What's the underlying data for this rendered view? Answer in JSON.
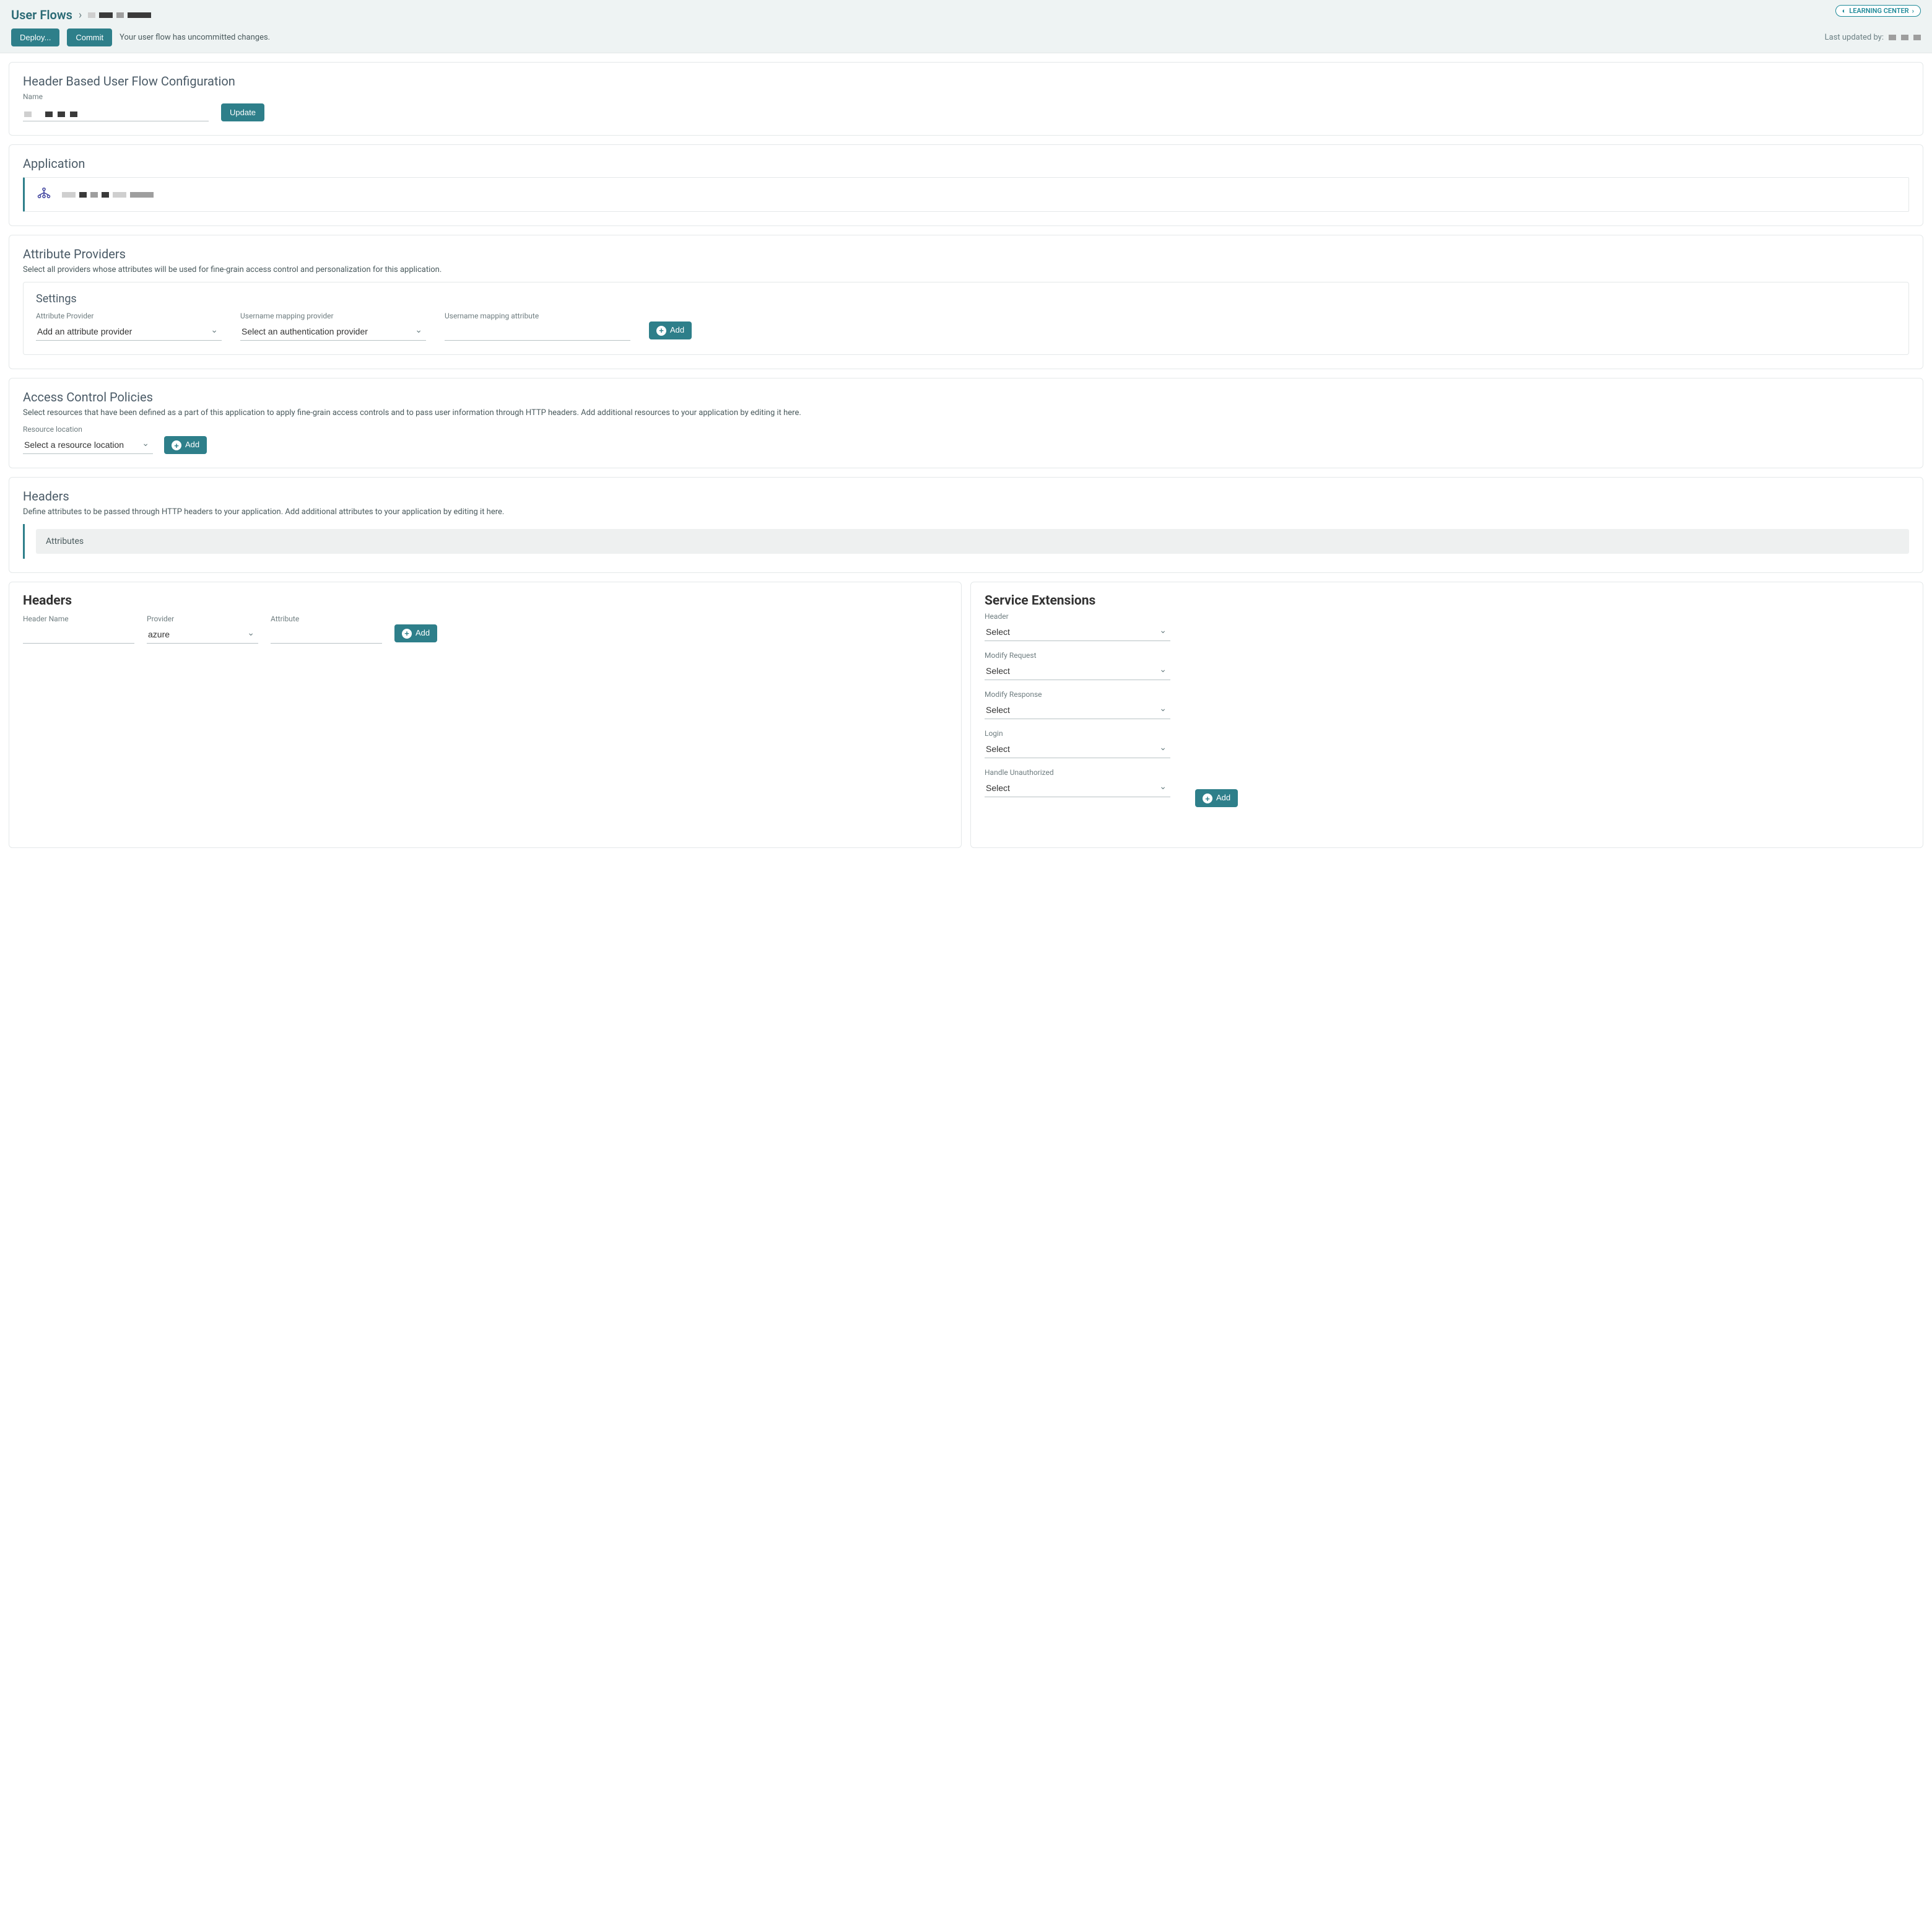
{
  "header": {
    "breadcrumb_root": "User Flows",
    "learning_center_label": "LEARNING CENTER",
    "deploy_label": "Deploy...",
    "commit_label": "Commit",
    "uncommitted_msg": "Your user flow has uncommitted changes.",
    "last_updated_label": "Last updated by:"
  },
  "config": {
    "title": "Header Based User Flow Configuration",
    "name_label": "Name",
    "update_label": "Update"
  },
  "application": {
    "title": "Application"
  },
  "providers": {
    "title": "Attribute Providers",
    "desc": "Select all providers whose attributes will be used for fine-grain access control and personalization for this application.",
    "settings_title": "Settings",
    "attr_provider_label": "Attribute Provider",
    "attr_provider_placeholder": "Add an attribute provider",
    "user_map_provider_label": "Username mapping provider",
    "user_map_provider_placeholder": "Select an authentication provider",
    "user_map_attr_label": "Username mapping attribute",
    "add_label": "Add"
  },
  "acp": {
    "title": "Access Control Policies",
    "desc": "Select resources that have been defined as a part of this application to apply fine-grain access controls and to pass user information through HTTP headers. Add additional resources to your application by editing it here.",
    "resource_label": "Resource location",
    "resource_placeholder": "Select a resource location",
    "add_label": "Add"
  },
  "headers_section": {
    "title": "Headers",
    "desc": "Define attributes to be passed through HTTP headers to your application. Add additional attributes to your application by editing it here.",
    "attributes_label": "Attributes"
  },
  "headers_form": {
    "title": "Headers",
    "header_name_label": "Header Name",
    "provider_label": "Provider",
    "provider_value": "azure",
    "attribute_label": "Attribute",
    "add_label": "Add"
  },
  "service_ext": {
    "title": "Service Extensions",
    "add_label": "Add",
    "fields": {
      "header": {
        "label": "Header",
        "value": "Select"
      },
      "modify_request": {
        "label": "Modify Request",
        "value": "Select"
      },
      "modify_response": {
        "label": "Modify Response",
        "value": "Select"
      },
      "login": {
        "label": "Login",
        "value": "Select"
      },
      "handle_unauthorized": {
        "label": "Handle Unauthorized",
        "value": "Select"
      }
    }
  }
}
